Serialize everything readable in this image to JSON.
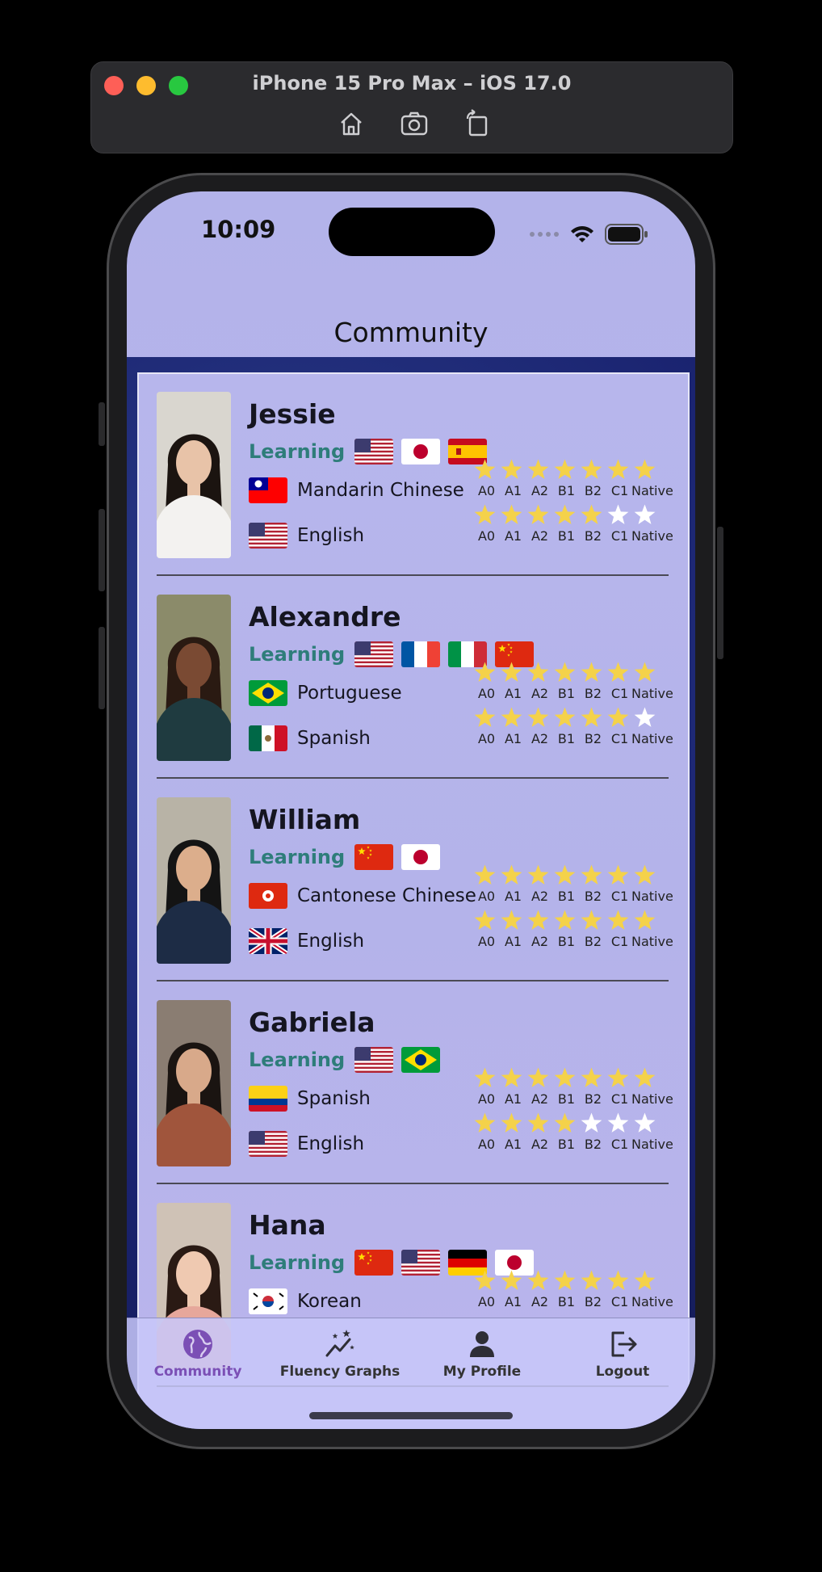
{
  "simulator": {
    "title": "iPhone 15 Pro Max – iOS 17.0",
    "tools": [
      "home-icon",
      "screenshot-icon",
      "rotate-icon"
    ]
  },
  "status_bar": {
    "time": "10:09"
  },
  "nav": {
    "title": "Community"
  },
  "star_color": "#f4d24a",
  "empty_star_color": "#ffffff",
  "accent_learning": "#2e7d7a",
  "tab_active_color": "#7b4fb5",
  "level_labels": [
    "A0",
    "A1",
    "A2",
    "B1",
    "B2",
    "C1",
    "Native"
  ],
  "learning_label": "Learning",
  "users": [
    {
      "name": "Jessie",
      "learning_flags": [
        "us",
        "jp",
        "es"
      ],
      "languages": [
        {
          "flag": "tw",
          "name": "Mandarin Chinese",
          "stars": 7
        },
        {
          "flag": "us",
          "name": "English",
          "stars": 5
        }
      ]
    },
    {
      "name": "Alexandre",
      "learning_flags": [
        "us",
        "fr",
        "it",
        "cn"
      ],
      "languages": [
        {
          "flag": "br",
          "name": "Portuguese",
          "stars": 7
        },
        {
          "flag": "mx",
          "name": "Spanish",
          "stars": 6
        }
      ]
    },
    {
      "name": "William",
      "learning_flags": [
        "cn",
        "jp"
      ],
      "languages": [
        {
          "flag": "hk",
          "name": "Cantonese Chinese",
          "stars": 7
        },
        {
          "flag": "gb",
          "name": "English",
          "stars": 7
        }
      ]
    },
    {
      "name": "Gabriela",
      "learning_flags": [
        "us",
        "br"
      ],
      "languages": [
        {
          "flag": "co",
          "name": "Spanish",
          "stars": 7
        },
        {
          "flag": "us",
          "name": "English",
          "stars": 4
        }
      ]
    },
    {
      "name": "Hana",
      "learning_flags": [
        "cn",
        "us",
        "de",
        "jp"
      ],
      "languages": [
        {
          "flag": "kr",
          "name": "Korean",
          "stars": 7
        }
      ]
    }
  ],
  "tabs": [
    {
      "label": "Community",
      "icon": "globe-icon",
      "active": true
    },
    {
      "label": "Fluency Graphs",
      "icon": "sparkle-chart-icon",
      "active": false
    },
    {
      "label": "My Profile",
      "icon": "person-icon",
      "active": false
    },
    {
      "label": "Logout",
      "icon": "logout-icon",
      "active": false
    }
  ]
}
